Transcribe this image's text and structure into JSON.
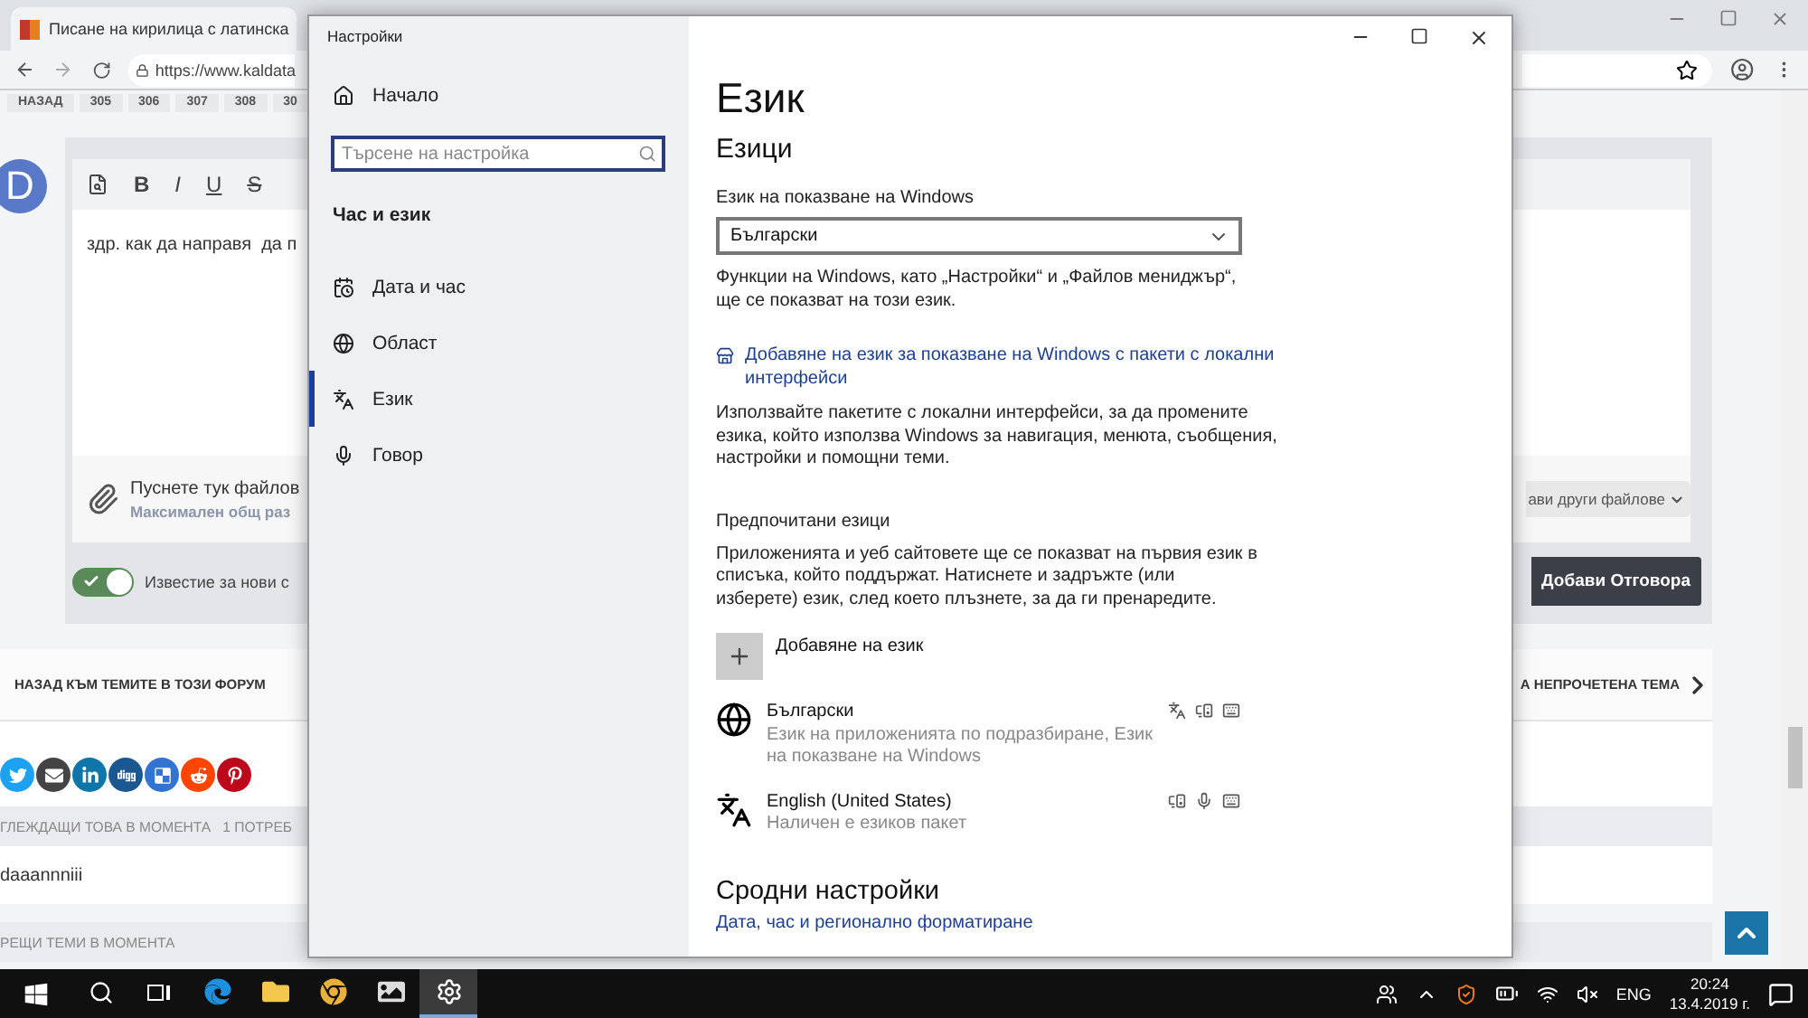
{
  "browser": {
    "tabs": [
      {
        "title": "Писане на кирилица с латинска",
        "selected": true
      }
    ],
    "url": "https://www.kaldata",
    "pager": [
      "НАЗАД",
      "305",
      "306",
      "307",
      "308",
      "30"
    ],
    "editor": {
      "avatar": "D",
      "format_buttons": [
        {
          "kind": "bold",
          "label": "B"
        },
        {
          "kind": "italic",
          "label": "I"
        },
        {
          "kind": "underline",
          "label": "U"
        },
        {
          "kind": "strike",
          "label": "S"
        }
      ],
      "text": "здр. как да направя  да п",
      "attach_title": "Пуснете тук файлов",
      "attach_note": "Максимален общ раз",
      "more_files_button": "ави други файлове",
      "notify_on": true,
      "notify_label": "Известие за нови с",
      "submit_button": "Добави Отговора"
    },
    "nav": {
      "back": "НАЗАД КЪМ ТЕМИТЕ В ТОЗИ ФОРУМ",
      "next": "А НЕПРОЧЕТЕНА ТЕМА"
    },
    "share": [
      {
        "kind": "twitter",
        "color": "#1da1f2"
      },
      {
        "kind": "email",
        "color": "#444444"
      },
      {
        "kind": "linkedin",
        "color": "#0e76a8"
      },
      {
        "kind": "digg",
        "color": "#1b5891"
      },
      {
        "kind": "delicious",
        "color": "#3274d1"
      },
      {
        "kind": "reddit",
        "color": "#ff4500"
      },
      {
        "kind": "pinterest",
        "color": "#bd081c"
      }
    ],
    "viewers_header": "ГЛЕЖДАЩИ ТОВА В МОМЕНТА   1 ПОТРЕБ",
    "viewers": [
      "daaannniii"
    ],
    "similar_header": "РЕЩИ ТЕМИ В МОМЕНТА"
  },
  "settings": {
    "title": "Настройки",
    "home": "Начало",
    "search_placeholder": "Търсене на настройка",
    "section": "Час и език",
    "nav": [
      {
        "kind": "date",
        "label": "Дата и час",
        "selected": false
      },
      {
        "kind": "region",
        "label": "Област",
        "selected": false
      },
      {
        "kind": "language",
        "label": "Език",
        "selected": true
      },
      {
        "kind": "speech",
        "label": "Говор",
        "selected": false
      }
    ],
    "page_title": "Език",
    "subtitle": "Езици",
    "display_label": "Език на показване на Windows",
    "display_value": "Български",
    "display_note": "Функции на Windows, като „Настройки“ и „Файлов мениджър“, ще се показват на този език.",
    "pack_link": "Добавяне на език за показване на Windows с пакети с локални интерфейси",
    "pack_note": "Използвайте пакетите с локални интерфейси, за да промените езика, който използва Windows за навигация, менюта, съобщения, настройки и помощни теми.",
    "preferred_label": "Предпочитани езици",
    "preferred_note": "Приложенията и уеб сайтовете ще се показват на първия език в списъка, който поддържат. Натиснете и задръжте (или изберете) език, след което плъзнете, за да ги пренаредите.",
    "add_button": "Добавяне на език",
    "languages": [
      {
        "name": "Български",
        "note": "Език на приложенията по подразбиране, Език на показване на Windows",
        "kind": "display",
        "display_feature": true,
        "speech_feature": true,
        "microphone_feature": false,
        "keyboard_feature": true
      },
      {
        "name": "English (United States)",
        "note": "Наличен е езиков пакет",
        "kind": "plain",
        "display_feature": false,
        "speech_feature": true,
        "microphone_feature": true,
        "keyboard_feature": true
      }
    ],
    "related_title": "Сродни настройки",
    "related_link": "Дата, час и регионално форматиране"
  },
  "taskbar": {
    "apps": [
      {
        "kind": "search",
        "selected": false
      },
      {
        "kind": "taskview",
        "selected": false
      },
      {
        "kind": "edge",
        "selected": false
      },
      {
        "kind": "folder",
        "selected": false
      },
      {
        "kind": "chrome",
        "selected": false
      },
      {
        "kind": "photos",
        "selected": false
      },
      {
        "kind": "settings",
        "selected": true
      }
    ],
    "lang": "ENG",
    "time": "20:24",
    "date": "13.4.2019 г."
  }
}
